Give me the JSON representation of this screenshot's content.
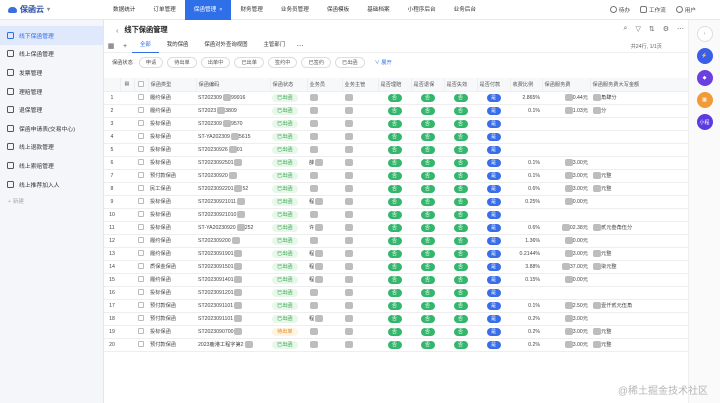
{
  "brand": {
    "name": "保函云"
  },
  "topnav": {
    "items": [
      "数据统计",
      "订单管理",
      "保函管理",
      "财务管理",
      "业务员管理",
      "保函模板",
      "基础档案",
      "小程序后台",
      "业务后台"
    ],
    "active_index": 2,
    "right": {
      "todo": "待办",
      "workbench": "工作流",
      "user": "用户"
    }
  },
  "sidebar": {
    "items": [
      "线下保函管理",
      "线上保函管理",
      "发票管理",
      "理赔管理",
      "退保管理",
      "保函申请表(交易中心)",
      "线上退款管理",
      "线上索赔管理",
      "线上推荐加入人"
    ],
    "active_index": 0,
    "add_label": "新建"
  },
  "header": {
    "title": "线下保函管理",
    "back": "‹"
  },
  "tabs": {
    "items": [
      "全部",
      "我的保函",
      "保函对外查询视图",
      "主管部门"
    ],
    "active_index": 0,
    "count": "共24行, 1/1页"
  },
  "filters": {
    "label": "保函状态",
    "chips": [
      "申请",
      "待出单",
      "出单中",
      "已出单",
      "签约中",
      "已签约",
      "已出函"
    ],
    "expand": "展开"
  },
  "table": {
    "columns": [
      "保函类型",
      "保函编码",
      "保函状态",
      "业务员",
      "业务主管",
      "是否理赔",
      "是否退保",
      "是否失效",
      "是否付款",
      "收费比例",
      "保函服务费",
      "保函服务费大写金额"
    ],
    "rows": [
      {
        "n": "1",
        "type": "履约保函",
        "code": "ST202309",
        "code2": "99916",
        "status": "已出函",
        "agent": "",
        "mgr": "",
        "c1": "否",
        "c2": "否",
        "c3": "否",
        "c4": "是",
        "rate": "2.865%",
        "fee": "0.44元",
        "feeText": "角肆分"
      },
      {
        "n": "2",
        "type": "履约保函",
        "code": "ST2023",
        "code2": "3809",
        "status": "已出函",
        "agent": "",
        "mgr": "",
        "c1": "否",
        "c2": "否",
        "c3": "否",
        "c4": "是",
        "rate": "0.1%",
        "fee": "1.03元",
        "feeText": "分"
      },
      {
        "n": "3",
        "type": "投标保函",
        "code": "ST202309",
        "code2": "9570",
        "status": "已出函",
        "agent": "",
        "mgr": "",
        "c1": "否",
        "c2": "否",
        "c3": "否",
        "c4": "是",
        "rate": "",
        "fee": "",
        "feeText": ""
      },
      {
        "n": "4",
        "type": "投标保函",
        "code": "ST-YA202309",
        "code2": "5615",
        "status": "已出函",
        "agent": "",
        "mgr": "",
        "c1": "否",
        "c2": "否",
        "c3": "否",
        "c4": "是",
        "rate": "",
        "fee": "",
        "feeText": ""
      },
      {
        "n": "5",
        "type": "投标保函",
        "code": "ST20230926",
        "code2": "01",
        "status": "已出函",
        "agent": "",
        "mgr": "",
        "c1": "否",
        "c2": "否",
        "c3": "否",
        "c4": "是",
        "rate": "",
        "fee": "",
        "feeText": ""
      },
      {
        "n": "6",
        "type": "投标保函",
        "code": "ST2023092501",
        "code2": "",
        "status": "已出函",
        "agent": "薛",
        "mgr": "",
        "c1": "否",
        "c2": "否",
        "c3": "否",
        "c4": "是",
        "rate": "0.1%",
        "fee": "3.00元",
        "feeText": ""
      },
      {
        "n": "7",
        "type": "预付款保函",
        "code": "ST20230920",
        "code2": "",
        "status": "已出函",
        "agent": "",
        "mgr": "",
        "c1": "否",
        "c2": "否",
        "c3": "否",
        "c4": "是",
        "rate": "0.1%",
        "fee": "3.00元",
        "feeText": "元整"
      },
      {
        "n": "8",
        "type": "民工保函",
        "code": "ST2023092201",
        "code2": "52",
        "status": "已出函",
        "agent": "",
        "mgr": "",
        "c1": "否",
        "c2": "否",
        "c3": "否",
        "c4": "是",
        "rate": "0.6%",
        "fee": "3.00元",
        "feeText": "元整"
      },
      {
        "n": "9",
        "type": "投标保函",
        "code": "ST20230921011",
        "code2": "",
        "status": "已出函",
        "agent": "程",
        "mgr": "",
        "c1": "否",
        "c2": "否",
        "c3": "否",
        "c4": "是",
        "rate": "0.25%",
        "fee": "0.00元",
        "feeText": ""
      },
      {
        "n": "10",
        "type": "投标保函",
        "code": "ST20230921010",
        "code2": "",
        "status": "已出函",
        "agent": "",
        "mgr": "",
        "c1": "否",
        "c2": "否",
        "c3": "否",
        "c4": "是",
        "rate": "",
        "fee": "",
        "feeText": ""
      },
      {
        "n": "11",
        "type": "投标保函",
        "code": "ST-YA20230920",
        "code2": "252",
        "status": "已出函",
        "agent": "许",
        "mgr": "",
        "c1": "否",
        "c2": "否",
        "c3": "否",
        "c4": "是",
        "rate": "0.6%",
        "fee": "02.38元",
        "feeText": "贰元叁角伍分"
      },
      {
        "n": "12",
        "type": "履约保函",
        "code": "ST202309200",
        "code2": "",
        "status": "已出函",
        "agent": "",
        "mgr": "",
        "c1": "否",
        "c2": "否",
        "c3": "否",
        "c4": "是",
        "rate": "1.36%",
        "fee": "0.00元",
        "feeText": ""
      },
      {
        "n": "13",
        "type": "履约保函",
        "code": "ST2023091901",
        "code2": "",
        "status": "已出函",
        "agent": "程",
        "mgr": "",
        "c1": "否",
        "c2": "否",
        "c3": "否",
        "c4": "是",
        "rate": "0.2144%",
        "fee": "3.00元",
        "feeText": "元整"
      },
      {
        "n": "14",
        "type": "质保金保函",
        "code": "ST2023091501",
        "code2": "",
        "status": "已出函",
        "agent": "程",
        "mgr": "",
        "c1": "否",
        "c2": "否",
        "c3": "否",
        "c4": "是",
        "rate": "3.88%",
        "fee": "37.00元",
        "feeText": "柒元整"
      },
      {
        "n": "15",
        "type": "履约保函",
        "code": "ST2023091401",
        "code2": "",
        "status": "已出函",
        "agent": "程",
        "mgr": "",
        "c1": "否",
        "c2": "否",
        "c3": "否",
        "c4": "是",
        "rate": "0.15%",
        "fee": "0.00元",
        "feeText": ""
      },
      {
        "n": "16",
        "type": "投标保函",
        "code": "ST2023091201",
        "code2": "",
        "status": "已出函",
        "agent": "",
        "mgr": "",
        "c1": "否",
        "c2": "否",
        "c3": "否",
        "c4": "是",
        "rate": "",
        "fee": "",
        "feeText": ""
      },
      {
        "n": "17",
        "type": "预付款保函",
        "code": "ST2023091101",
        "code2": "",
        "status": "已出函",
        "agent": "",
        "mgr": "",
        "c1": "否",
        "c2": "否",
        "c3": "否",
        "c4": "是",
        "rate": "0.1%",
        "fee": "2.50元",
        "feeText": "壹仟贰元伍角"
      },
      {
        "n": "18",
        "type": "预付款保函",
        "code": "ST2023091101",
        "code2": "",
        "status": "已出函",
        "agent": "程",
        "mgr": "",
        "c1": "否",
        "c2": "否",
        "c3": "否",
        "c4": "是",
        "rate": "0.2%",
        "fee": "3.00元",
        "feeText": ""
      },
      {
        "n": "19",
        "type": "投标保函",
        "code": "ST2023090700",
        "code2": "",
        "status": "待出单",
        "agent": "",
        "mgr": "",
        "c1": "否",
        "c2": "否",
        "c3": "否",
        "c4": "是",
        "rate": "0.2%",
        "fee": "3.00元",
        "feeText": "元整"
      },
      {
        "n": "20",
        "type": "预付款保函",
        "code": "2023鹿港工程字第2",
        "code2": "",
        "status": "已出函",
        "agent": "",
        "mgr": "",
        "c1": "否",
        "c2": "否",
        "c3": "否",
        "c4": "是",
        "rate": "0.2%",
        "fee": "3.00元",
        "feeText": "元整"
      }
    ]
  },
  "rightbar": {
    "buttons": [
      "",
      "",
      "",
      "",
      "小程"
    ]
  },
  "watermark": "@稀土掘金技术社区",
  "colors": {
    "accent": "#2f6fe8",
    "green": "#34b76c",
    "blue": "#3a6ee8"
  }
}
